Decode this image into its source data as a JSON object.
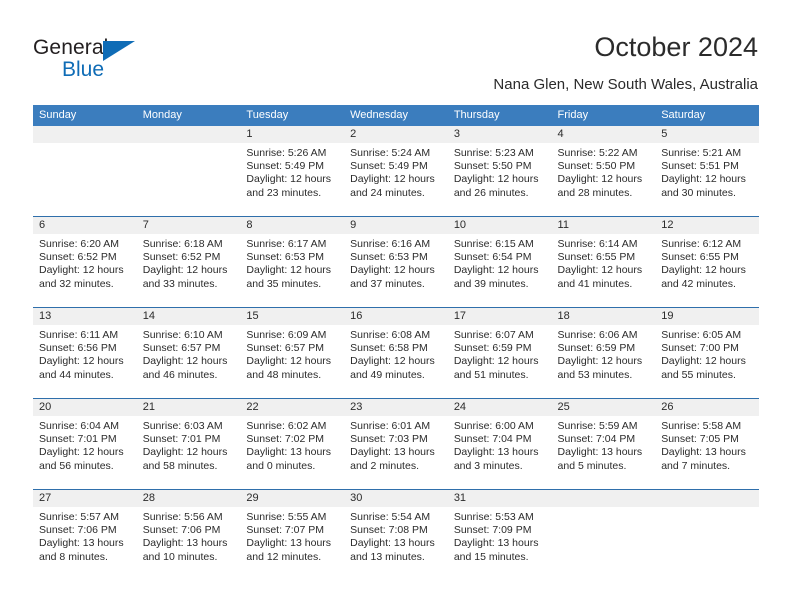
{
  "brand": {
    "name_part1": "General",
    "name_part2": "Blue",
    "accent_color": "#0f6cb6"
  },
  "header": {
    "title": "October 2024",
    "subtitle": "Nana Glen, New South Wales, Australia"
  },
  "theme": {
    "header_blue": "#3b7dbe",
    "rule_blue": "#2f6fab",
    "daynum_band": "#f0f0f0"
  },
  "weekdays": [
    "Sunday",
    "Monday",
    "Tuesday",
    "Wednesday",
    "Thursday",
    "Friday",
    "Saturday"
  ],
  "weeks": [
    [
      {
        "day": "",
        "sunrise": "",
        "sunset": "",
        "daylight_line1": "",
        "daylight_line2": ""
      },
      {
        "day": "",
        "sunrise": "",
        "sunset": "",
        "daylight_line1": "",
        "daylight_line2": ""
      },
      {
        "day": "1",
        "sunrise": "Sunrise: 5:26 AM",
        "sunset": "Sunset: 5:49 PM",
        "daylight_line1": "Daylight: 12 hours",
        "daylight_line2": "and 23 minutes."
      },
      {
        "day": "2",
        "sunrise": "Sunrise: 5:24 AM",
        "sunset": "Sunset: 5:49 PM",
        "daylight_line1": "Daylight: 12 hours",
        "daylight_line2": "and 24 minutes."
      },
      {
        "day": "3",
        "sunrise": "Sunrise: 5:23 AM",
        "sunset": "Sunset: 5:50 PM",
        "daylight_line1": "Daylight: 12 hours",
        "daylight_line2": "and 26 minutes."
      },
      {
        "day": "4",
        "sunrise": "Sunrise: 5:22 AM",
        "sunset": "Sunset: 5:50 PM",
        "daylight_line1": "Daylight: 12 hours",
        "daylight_line2": "and 28 minutes."
      },
      {
        "day": "5",
        "sunrise": "Sunrise: 5:21 AM",
        "sunset": "Sunset: 5:51 PM",
        "daylight_line1": "Daylight: 12 hours",
        "daylight_line2": "and 30 minutes."
      }
    ],
    [
      {
        "day": "6",
        "sunrise": "Sunrise: 6:20 AM",
        "sunset": "Sunset: 6:52 PM",
        "daylight_line1": "Daylight: 12 hours",
        "daylight_line2": "and 32 minutes."
      },
      {
        "day": "7",
        "sunrise": "Sunrise: 6:18 AM",
        "sunset": "Sunset: 6:52 PM",
        "daylight_line1": "Daylight: 12 hours",
        "daylight_line2": "and 33 minutes."
      },
      {
        "day": "8",
        "sunrise": "Sunrise: 6:17 AM",
        "sunset": "Sunset: 6:53 PM",
        "daylight_line1": "Daylight: 12 hours",
        "daylight_line2": "and 35 minutes."
      },
      {
        "day": "9",
        "sunrise": "Sunrise: 6:16 AM",
        "sunset": "Sunset: 6:53 PM",
        "daylight_line1": "Daylight: 12 hours",
        "daylight_line2": "and 37 minutes."
      },
      {
        "day": "10",
        "sunrise": "Sunrise: 6:15 AM",
        "sunset": "Sunset: 6:54 PM",
        "daylight_line1": "Daylight: 12 hours",
        "daylight_line2": "and 39 minutes."
      },
      {
        "day": "11",
        "sunrise": "Sunrise: 6:14 AM",
        "sunset": "Sunset: 6:55 PM",
        "daylight_line1": "Daylight: 12 hours",
        "daylight_line2": "and 41 minutes."
      },
      {
        "day": "12",
        "sunrise": "Sunrise: 6:12 AM",
        "sunset": "Sunset: 6:55 PM",
        "daylight_line1": "Daylight: 12 hours",
        "daylight_line2": "and 42 minutes."
      }
    ],
    [
      {
        "day": "13",
        "sunrise": "Sunrise: 6:11 AM",
        "sunset": "Sunset: 6:56 PM",
        "daylight_line1": "Daylight: 12 hours",
        "daylight_line2": "and 44 minutes."
      },
      {
        "day": "14",
        "sunrise": "Sunrise: 6:10 AM",
        "sunset": "Sunset: 6:57 PM",
        "daylight_line1": "Daylight: 12 hours",
        "daylight_line2": "and 46 minutes."
      },
      {
        "day": "15",
        "sunrise": "Sunrise: 6:09 AM",
        "sunset": "Sunset: 6:57 PM",
        "daylight_line1": "Daylight: 12 hours",
        "daylight_line2": "and 48 minutes."
      },
      {
        "day": "16",
        "sunrise": "Sunrise: 6:08 AM",
        "sunset": "Sunset: 6:58 PM",
        "daylight_line1": "Daylight: 12 hours",
        "daylight_line2": "and 49 minutes."
      },
      {
        "day": "17",
        "sunrise": "Sunrise: 6:07 AM",
        "sunset": "Sunset: 6:59 PM",
        "daylight_line1": "Daylight: 12 hours",
        "daylight_line2": "and 51 minutes."
      },
      {
        "day": "18",
        "sunrise": "Sunrise: 6:06 AM",
        "sunset": "Sunset: 6:59 PM",
        "daylight_line1": "Daylight: 12 hours",
        "daylight_line2": "and 53 minutes."
      },
      {
        "day": "19",
        "sunrise": "Sunrise: 6:05 AM",
        "sunset": "Sunset: 7:00 PM",
        "daylight_line1": "Daylight: 12 hours",
        "daylight_line2": "and 55 minutes."
      }
    ],
    [
      {
        "day": "20",
        "sunrise": "Sunrise: 6:04 AM",
        "sunset": "Sunset: 7:01 PM",
        "daylight_line1": "Daylight: 12 hours",
        "daylight_line2": "and 56 minutes."
      },
      {
        "day": "21",
        "sunrise": "Sunrise: 6:03 AM",
        "sunset": "Sunset: 7:01 PM",
        "daylight_line1": "Daylight: 12 hours",
        "daylight_line2": "and 58 minutes."
      },
      {
        "day": "22",
        "sunrise": "Sunrise: 6:02 AM",
        "sunset": "Sunset: 7:02 PM",
        "daylight_line1": "Daylight: 13 hours",
        "daylight_line2": "and 0 minutes."
      },
      {
        "day": "23",
        "sunrise": "Sunrise: 6:01 AM",
        "sunset": "Sunset: 7:03 PM",
        "daylight_line1": "Daylight: 13 hours",
        "daylight_line2": "and 2 minutes."
      },
      {
        "day": "24",
        "sunrise": "Sunrise: 6:00 AM",
        "sunset": "Sunset: 7:04 PM",
        "daylight_line1": "Daylight: 13 hours",
        "daylight_line2": "and 3 minutes."
      },
      {
        "day": "25",
        "sunrise": "Sunrise: 5:59 AM",
        "sunset": "Sunset: 7:04 PM",
        "daylight_line1": "Daylight: 13 hours",
        "daylight_line2": "and 5 minutes."
      },
      {
        "day": "26",
        "sunrise": "Sunrise: 5:58 AM",
        "sunset": "Sunset: 7:05 PM",
        "daylight_line1": "Daylight: 13 hours",
        "daylight_line2": "and 7 minutes."
      }
    ],
    [
      {
        "day": "27",
        "sunrise": "Sunrise: 5:57 AM",
        "sunset": "Sunset: 7:06 PM",
        "daylight_line1": "Daylight: 13 hours",
        "daylight_line2": "and 8 minutes."
      },
      {
        "day": "28",
        "sunrise": "Sunrise: 5:56 AM",
        "sunset": "Sunset: 7:06 PM",
        "daylight_line1": "Daylight: 13 hours",
        "daylight_line2": "and 10 minutes."
      },
      {
        "day": "29",
        "sunrise": "Sunrise: 5:55 AM",
        "sunset": "Sunset: 7:07 PM",
        "daylight_line1": "Daylight: 13 hours",
        "daylight_line2": "and 12 minutes."
      },
      {
        "day": "30",
        "sunrise": "Sunrise: 5:54 AM",
        "sunset": "Sunset: 7:08 PM",
        "daylight_line1": "Daylight: 13 hours",
        "daylight_line2": "and 13 minutes."
      },
      {
        "day": "31",
        "sunrise": "Sunrise: 5:53 AM",
        "sunset": "Sunset: 7:09 PM",
        "daylight_line1": "Daylight: 13 hours",
        "daylight_line2": "and 15 minutes."
      },
      {
        "day": "",
        "sunrise": "",
        "sunset": "",
        "daylight_line1": "",
        "daylight_line2": ""
      },
      {
        "day": "",
        "sunrise": "",
        "sunset": "",
        "daylight_line1": "",
        "daylight_line2": ""
      }
    ]
  ]
}
